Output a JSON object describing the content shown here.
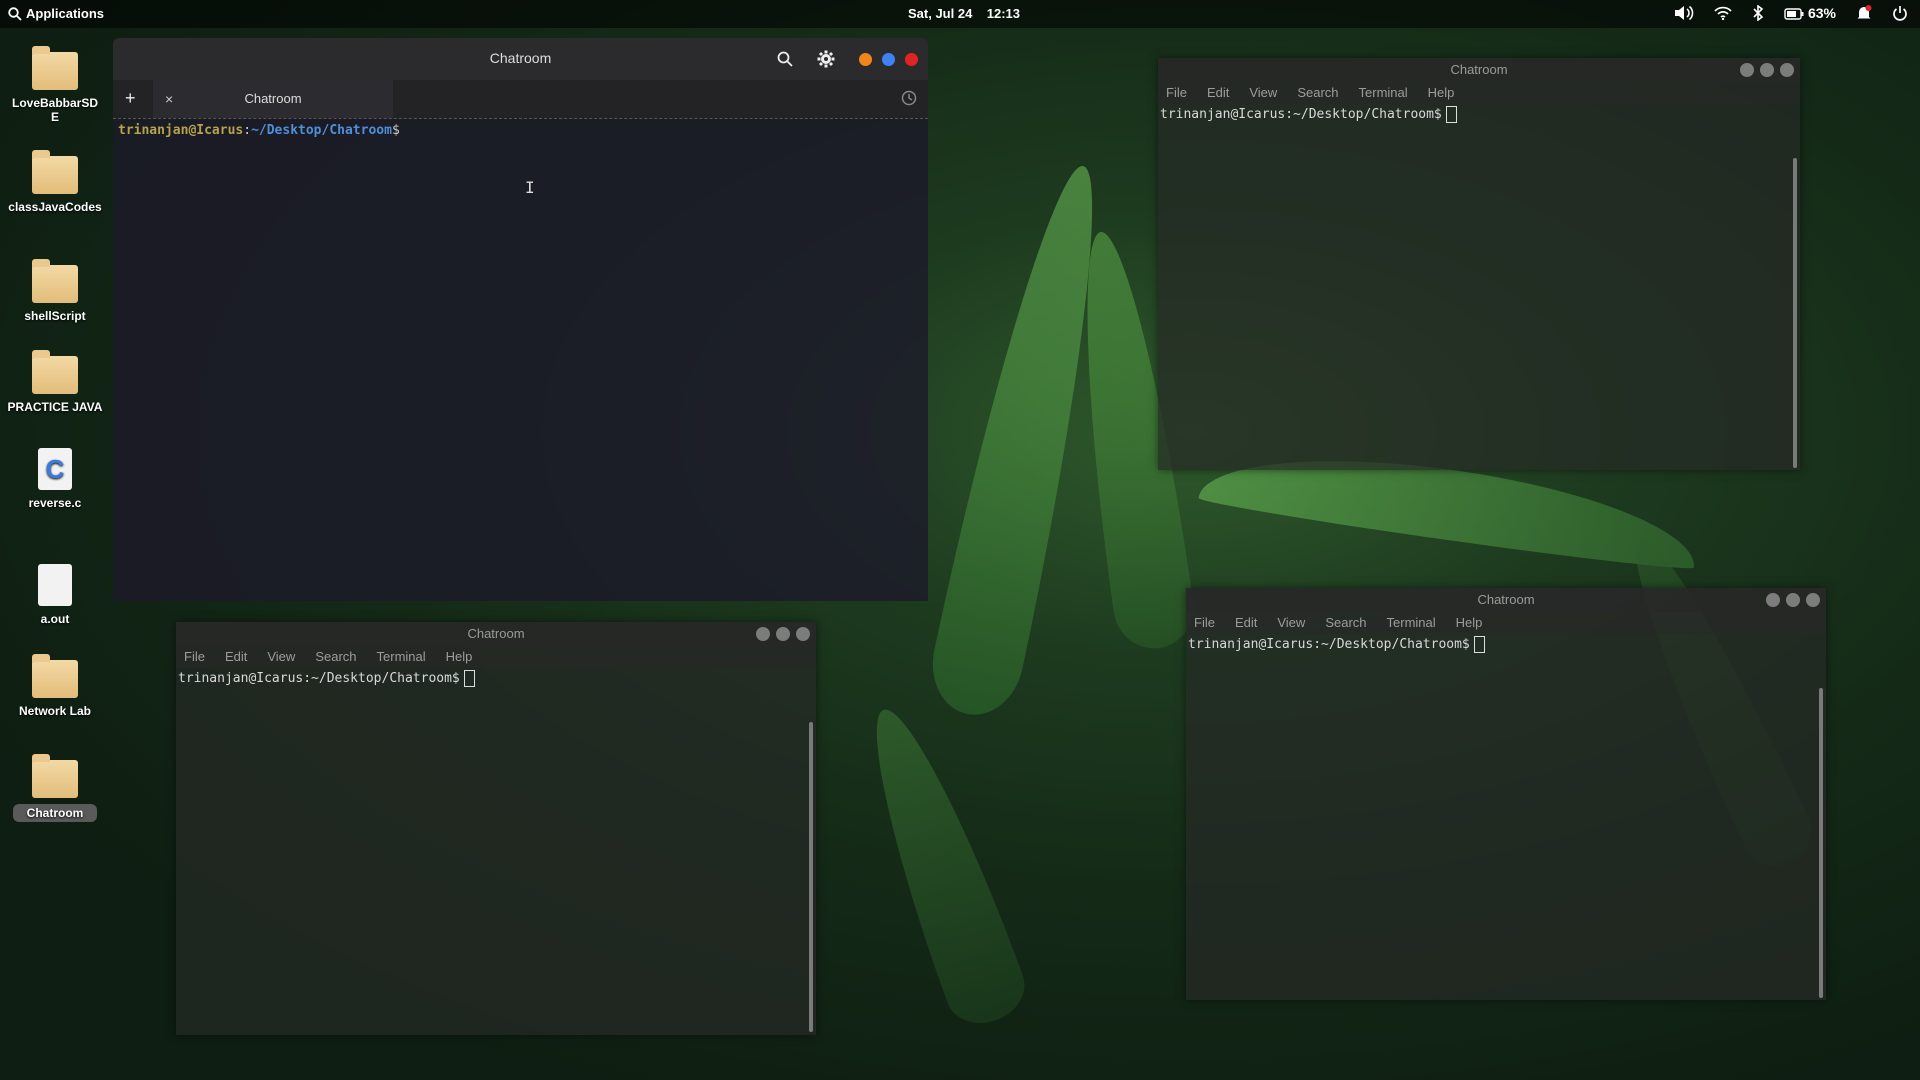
{
  "topbar": {
    "apps_label": "Applications",
    "date": "Sat, Jul 24",
    "time": "12:13",
    "battery": "63%"
  },
  "desktop": {
    "items": [
      {
        "label": "LoveBabbarSDE",
        "type": "folder"
      },
      {
        "label": "classJavaCodes",
        "type": "folder"
      },
      {
        "label": "shellScript",
        "type": "folder"
      },
      {
        "label": "PRACTICE JAVA",
        "type": "folder"
      },
      {
        "label": "reverse.c",
        "type": "c-file",
        "glyph": "C"
      },
      {
        "label": "a.out",
        "type": "file"
      },
      {
        "label": "Network Lab",
        "type": "folder"
      },
      {
        "label": "Chatroom",
        "type": "folder",
        "selected": true
      }
    ]
  },
  "main_window": {
    "title": "Chatroom",
    "tab_label": "Chatroom",
    "add_tab": "+",
    "close_tab": "×",
    "prompt": {
      "user": "trinanjan@Icarus",
      "sep": ":",
      "path": "~/Desktop/Chatroom",
      "symbol": "$"
    },
    "ctrl_colors": {
      "min": "#f0851a",
      "max": "#3d82f0",
      "close": "#e02424"
    }
  },
  "terminals": [
    {
      "title": "Chatroom",
      "menu": [
        "File",
        "Edit",
        "View",
        "Search",
        "Terminal",
        "Help"
      ],
      "line": "trinanjan@Icarus:~/Desktop/Chatroom$"
    },
    {
      "title": "Chatroom",
      "menu": [
        "File",
        "Edit",
        "View",
        "Search",
        "Terminal",
        "Help"
      ],
      "line": "trinanjan@Icarus:~/Desktop/Chatroom$"
    },
    {
      "title": "Chatroom",
      "menu": [
        "File",
        "Edit",
        "View",
        "Search",
        "Terminal",
        "Help"
      ],
      "line": "trinanjan@Icarus:~/Desktop/Chatroom$"
    }
  ]
}
